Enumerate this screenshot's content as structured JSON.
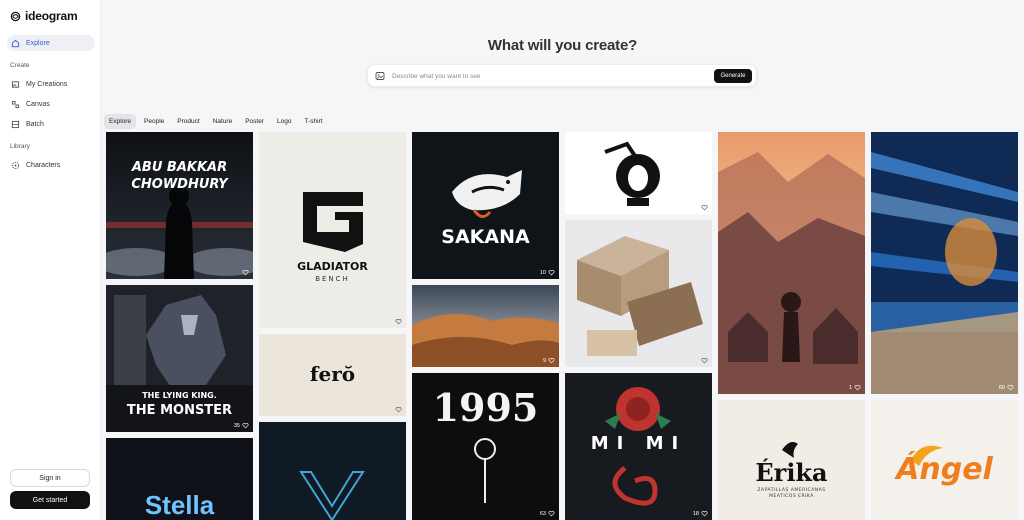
{
  "app": {
    "name": "ideogram"
  },
  "sidebar": {
    "explore_label": "Explore",
    "create_section": "Create",
    "my_creations_label": "My Creations",
    "canvas_label": "Canvas",
    "batch_label": "Batch",
    "library_section": "Library",
    "characters_label": "Characters",
    "signin_label": "Sign in",
    "get_started_label": "Get started"
  },
  "header": {
    "title": "What will you create?",
    "prompt_placeholder": "Describe what you want to see",
    "generate_label": "Generate"
  },
  "tabs": [
    "Explore",
    "People",
    "Product",
    "Nature",
    "Poster",
    "Logo",
    "T-shirt"
  ],
  "cards": {
    "abu": {
      "line1": "ABU BAKKAR",
      "line2": "CHOWDHURY",
      "likes": ""
    },
    "gladiator": {
      "line1": "GLADIATOR",
      "line2": "BENCH",
      "likes": ""
    },
    "sakana": {
      "text": "SAKANA",
      "likes": "10"
    },
    "dunes": {
      "likes": "9"
    },
    "woman_logo": {
      "likes": ""
    },
    "box": {
      "likes": ""
    },
    "boy": {
      "likes": "1"
    },
    "streaks": {
      "likes": "60"
    },
    "monster": {
      "line1": "THE LYING KING.",
      "line2": "THE MONSTER",
      "likes": "35"
    },
    "fero": {
      "text": "ferŏ",
      "likes": ""
    },
    "year": {
      "text": "1995",
      "likes": "63"
    },
    "mimi": {
      "text": "MI MI",
      "likes": "18"
    },
    "stella": {
      "text": "Stella"
    },
    "erika": {
      "text": "Érika",
      "sub1": "ZAPATILLAS AMERICANAS",
      "sub2": "MEATICOS ERIKA"
    },
    "angel": {
      "text": "Ángel"
    }
  },
  "colors": {
    "accent": "#3b5bdb",
    "dark_button": "#111111"
  }
}
